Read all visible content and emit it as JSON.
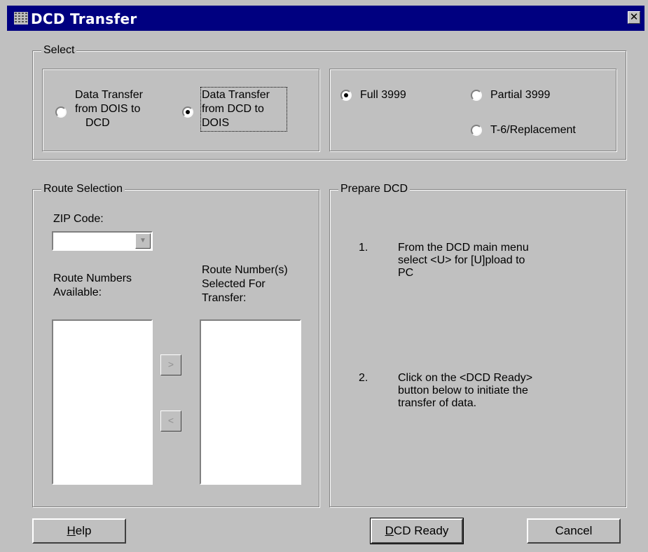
{
  "window": {
    "title": "DCD Transfer",
    "close_glyph": "✕"
  },
  "select_group": {
    "label": "Select",
    "direction": {
      "option1": {
        "line1": "Data Transfer",
        "line2": "from DOIS to",
        "line3": "DCD",
        "checked": false
      },
      "option2": {
        "line1": "Data Transfer",
        "line2": "from DCD to",
        "line3": "DOIS",
        "checked": true
      }
    },
    "type": {
      "full": {
        "label": "Full 3999",
        "checked": true
      },
      "partial": {
        "label": "Partial 3999",
        "checked": false
      },
      "t6": {
        "label": "T-6/Replacement",
        "checked": false
      }
    }
  },
  "route_selection": {
    "label": "Route Selection",
    "zip_label": "ZIP Code:",
    "zip_value": "",
    "available_line1": "Route Numbers",
    "available_line2": "Available:",
    "selected_line1": "Route Number(s)",
    "selected_line2": "Selected For",
    "selected_line3": "Transfer:",
    "add_glyph": ">",
    "remove_glyph": "<",
    "available_items": [],
    "selected_items": []
  },
  "prepare_dcd": {
    "label": "Prepare DCD",
    "step1_num": "1.",
    "step1_line1": "From the DCD main menu",
    "step1_line2": "select <U> for [U]pload to",
    "step1_line3": "PC",
    "step2_num": "2.",
    "step2_line1": "Click on the <DCD Ready>",
    "step2_line2": "button below to initiate the",
    "step2_line3": "transfer of data."
  },
  "buttons": {
    "help": {
      "mnemonic": "H",
      "rest": "elp"
    },
    "dcd_ready": {
      "mnemonic": "D",
      "rest": "CD Ready"
    },
    "cancel": {
      "label": "Cancel"
    }
  },
  "colors": {
    "titlebar": "#000080",
    "face": "#c0c0c0"
  },
  "icons": {
    "app": "app-icon",
    "close": "close-icon",
    "dropdown": "dropdown-arrow-icon"
  }
}
